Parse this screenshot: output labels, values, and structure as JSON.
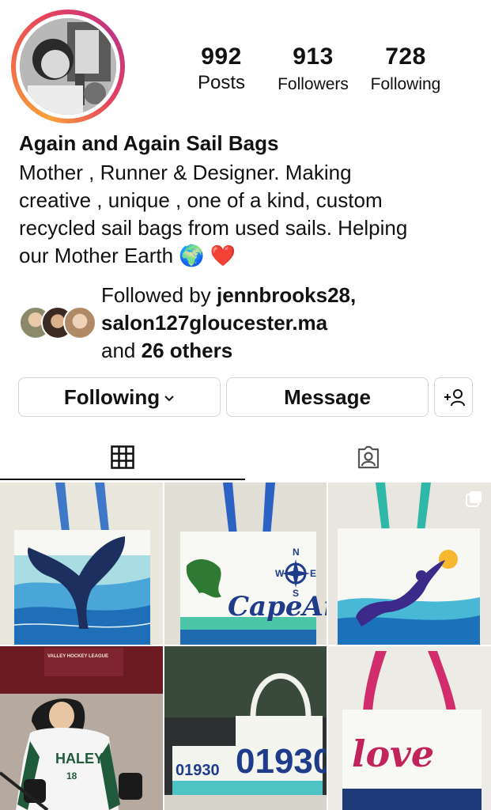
{
  "profile": {
    "name": "Again and Again Sail Bags",
    "bio_line1": "Mother , Runner & Designer. Making",
    "bio_line2": "creative , unique , one of a kind, custom",
    "bio_line3": "recycled sail bags from used sails. Helping",
    "bio_line4": "our Mother Earth 🌍 ❤️"
  },
  "stats": {
    "posts": {
      "value": "992",
      "label": "Posts"
    },
    "followers": {
      "value": "913",
      "label": "Followers"
    },
    "following": {
      "value": "728",
      "label": "Following"
    }
  },
  "followed_by": {
    "prefix": "Followed by ",
    "user1": "jennbrooks28",
    "comma": ",",
    "user2": "salon127gloucester.ma",
    "and": "and ",
    "others": "26 others"
  },
  "actions": {
    "following_label": "Following",
    "message_label": "Message"
  },
  "tabs": {
    "grid_icon": "grid-icon",
    "tagged_icon": "tagged-icon"
  },
  "posts": [
    {
      "label": "whale tail sail bag"
    },
    {
      "label": "Cape Ann sail bag",
      "text": "CapeAnn",
      "compass": "N W E S"
    },
    {
      "label": "mermaid sail bag"
    },
    {
      "label": "hockey player photo",
      "jersey": "HALEY",
      "number": "18",
      "banner": "VALLEY HOCKEY LEAGUE"
    },
    {
      "label": "01930 sail bags",
      "text_small": "01930",
      "text_big": "01930"
    },
    {
      "label": "love sail bag",
      "text": "love"
    }
  ],
  "colors": {
    "brand_ring_start": "#f9a13a",
    "brand_ring_end": "#c13584",
    "border": "#d3d3d3"
  }
}
